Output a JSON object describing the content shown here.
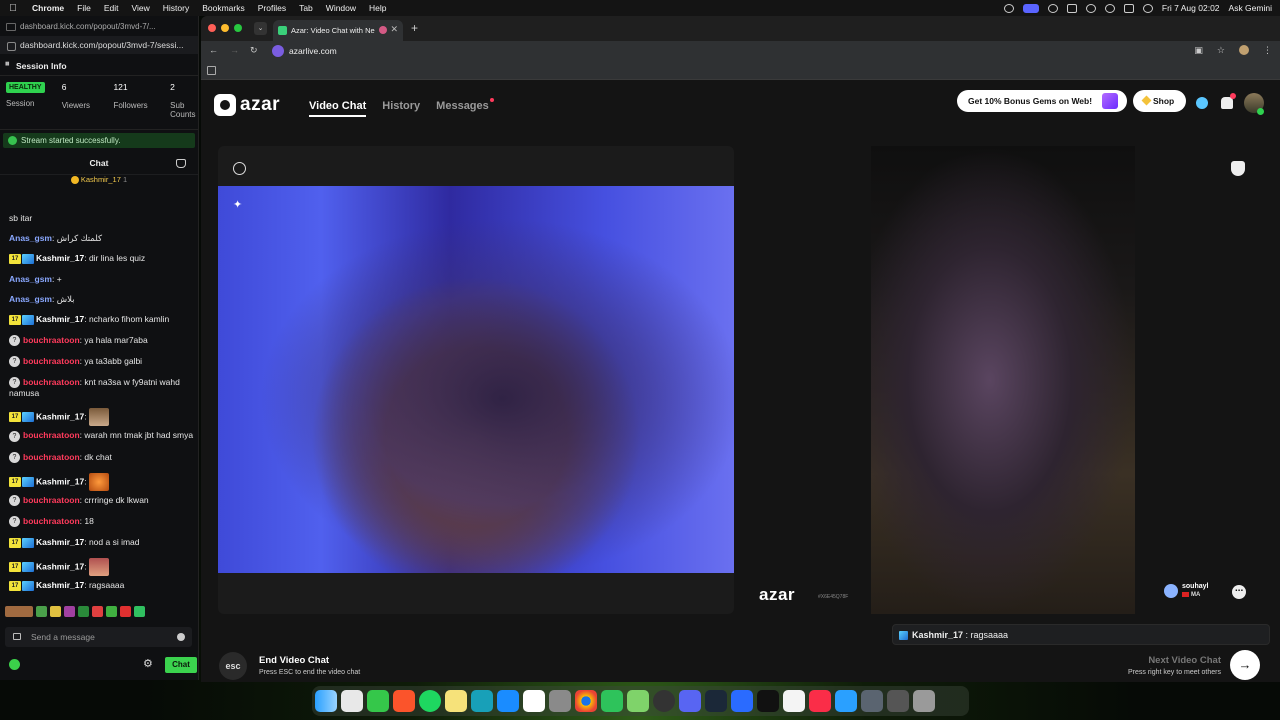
{
  "menubar": {
    "app": "Chrome",
    "items": [
      "File",
      "Edit",
      "View",
      "History",
      "Bookmarks",
      "Profiles",
      "Tab",
      "Window",
      "Help"
    ],
    "ask": "Ask Gemini",
    "datetime": "Fri 7 Aug  02:02"
  },
  "left_window": {
    "url_bar": "dashboard.kick.com/popout/3mvd-7/...",
    "url": "dashboard.kick.com/popout/3mvd-7/sessi...",
    "session_title": "Session Info",
    "stats": {
      "status": "HEALTHY",
      "status_label": "Session",
      "viewers_value": "6",
      "viewers_label": "Viewers",
      "followers_value": "121",
      "followers_label": "Followers",
      "subs_value": "2",
      "subs_label": "Sub Counts"
    },
    "success_message": "Stream started successfully.",
    "chat_title": "Chat",
    "pinned_user": "Kashmir_17",
    "pinned_count": "1",
    "messages": [
      {
        "badge": "",
        "user": "",
        "type": "none",
        "text": "sb itar"
      },
      {
        "badge": "",
        "user": "Anas_gsm",
        "type": "anas",
        "text": "كلمتك كراش"
      },
      {
        "badge": "17",
        "user": "Kashmir_17",
        "type": "kash",
        "text": "dir lina les quiz"
      },
      {
        "badge": "",
        "user": "Anas_gsm",
        "type": "anas",
        "text": "+"
      },
      {
        "badge": "",
        "user": "Anas_gsm",
        "type": "anas",
        "text": "بلاش"
      },
      {
        "badge": "17",
        "user": "Kashmir_17",
        "type": "kash",
        "text": "ncharko fihom kamlin"
      },
      {
        "badge": "?",
        "user": "bouchraatoon",
        "type": "bouch",
        "text": "ya hala mar7aba"
      },
      {
        "badge": "?",
        "user": "bouchraatoon",
        "type": "bouch",
        "text": "ya ta3abb galbi"
      },
      {
        "badge": "?",
        "user": "bouchraatoon",
        "type": "bouch",
        "text": "knt na3sa w fy9atni wahd namusa"
      },
      {
        "badge": "17",
        "user": "Kashmir_17",
        "type": "kash",
        "text": "",
        "emote": "e1"
      },
      {
        "badge": "?",
        "user": "bouchraatoon",
        "type": "bouch",
        "text": "warah mn tmak jbt had smya"
      },
      {
        "badge": "?",
        "user": "bouchraatoon",
        "type": "bouch",
        "text": "dk chat"
      },
      {
        "badge": "17",
        "user": "Kashmir_17",
        "type": "kash",
        "text": "",
        "emote": "e2"
      },
      {
        "badge": "?",
        "user": "bouchraatoon",
        "type": "bouch",
        "text": "crrringe dk lkwan"
      },
      {
        "badge": "?",
        "user": "bouchraatoon",
        "type": "bouch",
        "text": "18"
      },
      {
        "badge": "17",
        "user": "Kashmir_17",
        "type": "kash",
        "text": "nod a si imad"
      },
      {
        "badge": "17",
        "user": "Kashmir_17",
        "type": "kash",
        "text": "",
        "emote": "e3"
      },
      {
        "badge": "17",
        "user": "Kashmir_17",
        "type": "kash",
        "text": "ragsaaaa"
      }
    ],
    "send_placeholder": "Send a message",
    "chat_button": "Chat"
  },
  "chrome": {
    "tab_title": "Azar: Video Chat with Ne",
    "url": "azarlive.com"
  },
  "azar": {
    "logo": "azar",
    "nav": [
      "Video Chat",
      "History",
      "Messages"
    ],
    "bonus": "Get 10% Bonus Gems on Web!",
    "shop": "Shop",
    "watermark": "azar",
    "watermark_id": "#X6E45Q78F",
    "peer_name": "souhayl",
    "peer_country": "MA",
    "chat_toast_user": "Kashmir_17",
    "chat_toast_text": " : ragsaaaa",
    "esc_label": "esc",
    "end_title": "End Video Chat",
    "end_sub": "Press ESC to end the video chat",
    "next_title": "Next Video Chat",
    "next_sub": "Press right key to meet others"
  },
  "colors": {
    "kick_green": "#3bd24e",
    "bouch_red": "#ff3b5c",
    "anas_blue": "#8aa8ff"
  }
}
